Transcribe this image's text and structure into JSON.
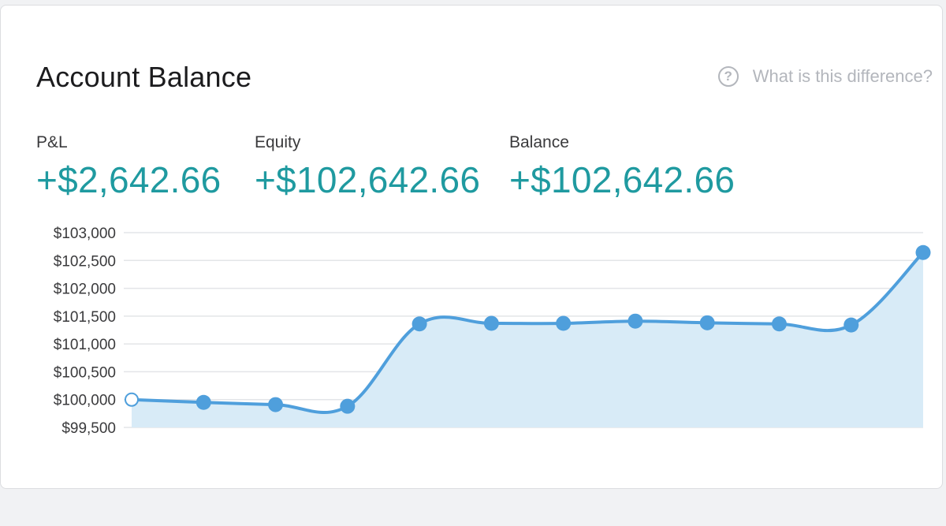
{
  "card": {
    "title": "Account Balance",
    "help_text": "What is this difference?",
    "help_icon": "?"
  },
  "stats": {
    "pnl": {
      "label": "P&L",
      "value": "+$2,642.66"
    },
    "equity": {
      "label": "Equity",
      "value": "+$102,642.66"
    },
    "balance": {
      "label": "Balance",
      "value": "+$102,642.66"
    }
  },
  "colors": {
    "accent": "#1f9aa0",
    "line": "#4f9fdc",
    "fill": "#d8ebf7",
    "grid": "#e3e5e8"
  },
  "chart_data": {
    "type": "area",
    "x": [
      1,
      2,
      3,
      4,
      5,
      6,
      7,
      8,
      9,
      10,
      11,
      12
    ],
    "series": [
      {
        "values": [
          100000,
          99950,
          99910,
          99880,
          101360,
          101370,
          101370,
          101410,
          101380,
          101360,
          101340,
          102642.66
        ]
      }
    ],
    "ylim": [
      99500,
      103000
    ],
    "yticks": [
      103000,
      102500,
      102000,
      101500,
      101000,
      100500,
      100000,
      99500
    ],
    "ytick_labels": [
      "$103,000",
      "$102,500",
      "$102,000",
      "$101,500",
      "$101,000",
      "$100,500",
      "$100,000",
      "$99,500"
    ],
    "grid": true,
    "first_point_hollow": true
  }
}
